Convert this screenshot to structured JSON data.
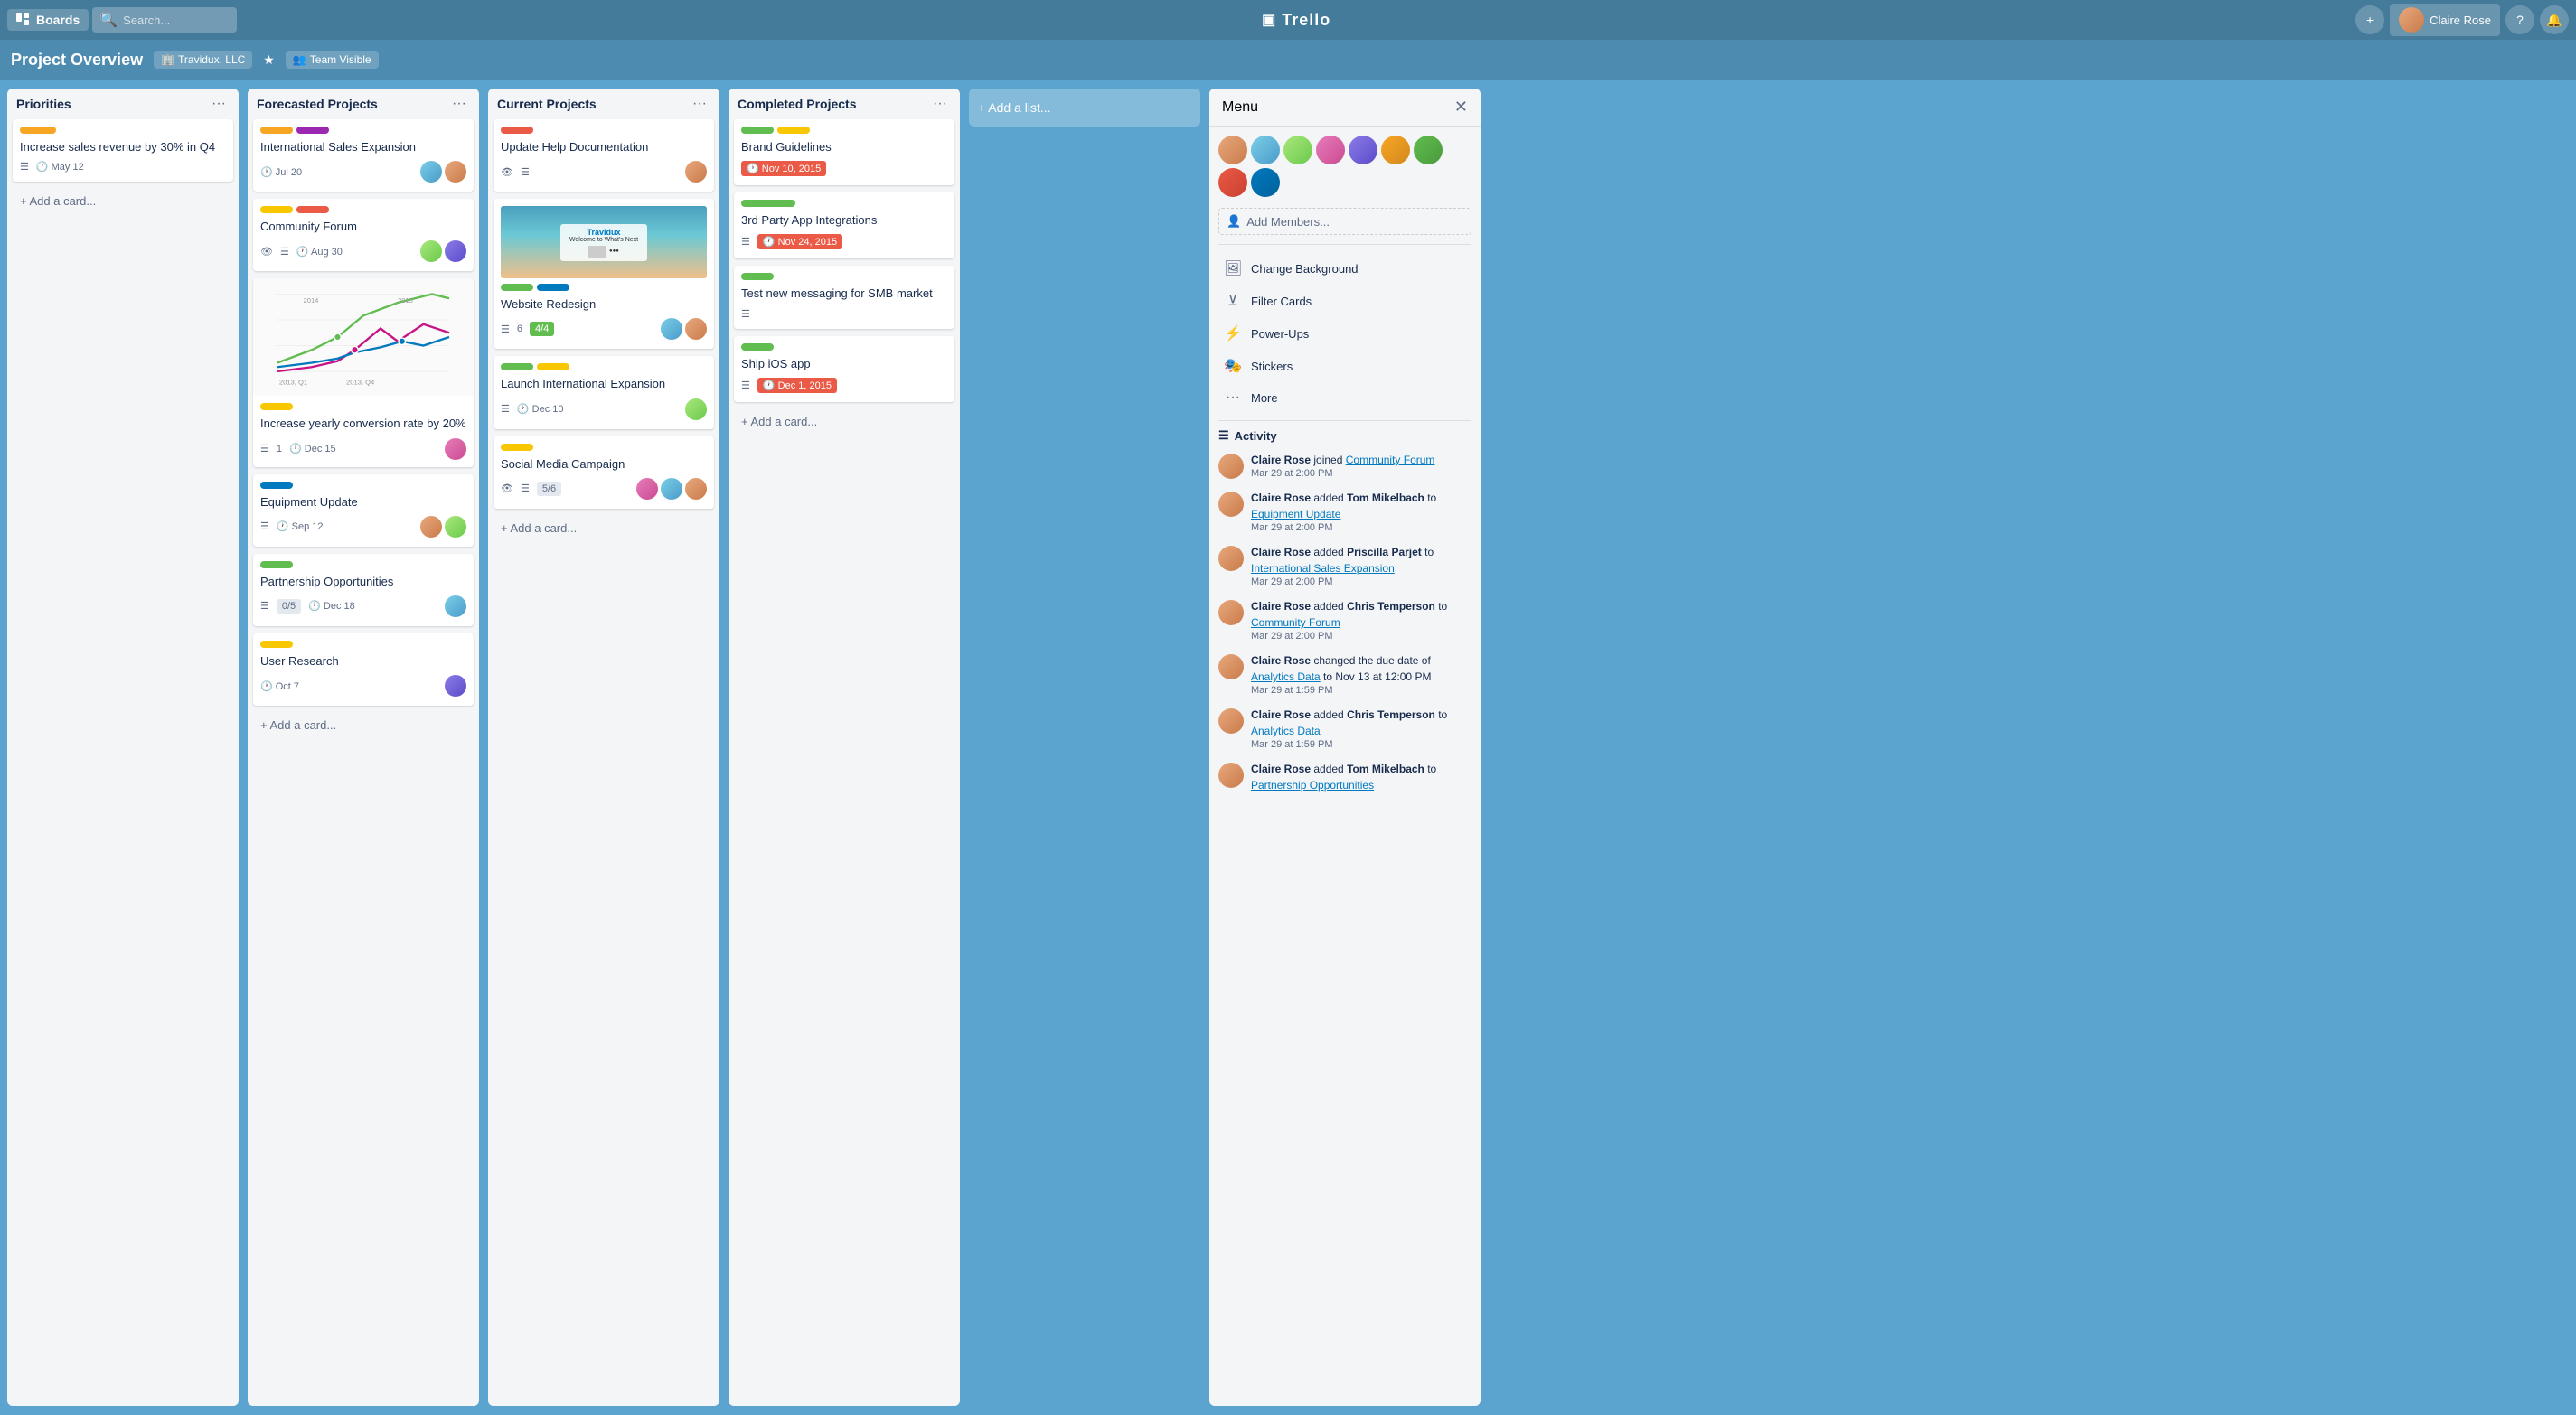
{
  "header": {
    "boards_label": "Boards",
    "search_placeholder": "Search...",
    "logo_text": "Trello",
    "add_btn": "+",
    "user_name": "Claire Rose",
    "help_icon": "?",
    "bell_icon": "🔔"
  },
  "board": {
    "title": "Project Overview",
    "org": "Travidux, LLC",
    "visibility": "Team Visible"
  },
  "columns": [
    {
      "id": "priorities",
      "title": "Priorities",
      "cards": [
        {
          "id": "p1",
          "labels": [
            {
              "color": "#f6a623",
              "width": 40
            }
          ],
          "title": "Increase sales revenue by 30% in Q4",
          "meta": [
            "checklist",
            "due"
          ],
          "due": "May 12",
          "due_style": "normal"
        }
      ]
    },
    {
      "id": "forecasted",
      "title": "Forecasted Projects",
      "cards": [
        {
          "id": "f1",
          "labels": [
            {
              "color": "#f6a623",
              "width": 36
            },
            {
              "color": "#9c27b0",
              "width": 36
            }
          ],
          "title": "International Sales Expansion",
          "due": "Jul 20",
          "due_style": "normal",
          "avatars": [
            "avatar-2",
            "avatar-1"
          ]
        },
        {
          "id": "f2",
          "labels": [
            {
              "color": "#f9c700",
              "width": 36
            },
            {
              "color": "#eb5a46",
              "width": 36
            }
          ],
          "title": "Community Forum",
          "due": "Aug 30",
          "due_style": "normal",
          "avatars": [
            "avatar-3",
            "avatar-5"
          ]
        },
        {
          "id": "f3",
          "chart": true,
          "labels": [
            {
              "color": "#f9c700",
              "width": 36
            }
          ],
          "title": "Increase yearly conversion rate by 20%",
          "checklist_count": "1",
          "due": "Dec 15",
          "due_style": "normal",
          "avatars": [
            "avatar-4"
          ]
        },
        {
          "id": "f4",
          "labels": [
            {
              "color": "#0079bf",
              "width": 36
            }
          ],
          "title": "Equipment Update",
          "due": "Sep 12",
          "due_style": "normal",
          "avatars": [
            "avatar-1",
            "avatar-3"
          ]
        },
        {
          "id": "f5",
          "labels": [
            {
              "color": "#61bd4f",
              "width": 36
            }
          ],
          "title": "Partnership Opportunities",
          "checklist": "0/5",
          "due": "Dec 18",
          "due_style": "normal",
          "avatars": [
            "avatar-2"
          ]
        },
        {
          "id": "f6",
          "labels": [
            {
              "color": "#f9c700",
              "width": 36
            }
          ],
          "title": "User Research",
          "due": "Oct 7",
          "due_style": "normal",
          "avatars": [
            "avatar-5"
          ]
        }
      ]
    },
    {
      "id": "current",
      "title": "Current Projects",
      "cards": [
        {
          "id": "c1",
          "labels": [
            {
              "color": "#eb5a46",
              "width": 36
            }
          ],
          "title": "Update Help Documentation",
          "has_image": false,
          "has_eye": true,
          "has_checklist_icon": true,
          "avatars": [
            "avatar-1"
          ]
        },
        {
          "id": "c2",
          "labels": [
            {
              "color": "#61bd4f",
              "width": 36
            },
            {
              "color": "#0079bf",
              "width": 36
            }
          ],
          "title": "Website Redesign",
          "has_website_img": true,
          "checklist": "4/4",
          "checklist_style": "green",
          "checklist_count": "6",
          "avatars": [
            "avatar-2",
            "avatar-1"
          ]
        },
        {
          "id": "c3",
          "labels": [
            {
              "color": "#61bd4f",
              "width": 36
            },
            {
              "color": "#f9c700",
              "width": 36
            }
          ],
          "title": "Launch International Expansion",
          "due": "Dec 10",
          "due_style": "normal",
          "avatars": [
            "avatar-3"
          ]
        },
        {
          "id": "c4",
          "labels": [
            {
              "color": "#f9c700",
              "width": 36
            }
          ],
          "title": "Social Media Campaign",
          "has_eye": true,
          "has_checklist_icon": true,
          "checklist": "5/6",
          "avatars": [
            "avatar-4",
            "avatar-2",
            "avatar-1"
          ]
        }
      ]
    },
    {
      "id": "completed",
      "title": "Completed Projects",
      "cards": [
        {
          "id": "cp1",
          "labels": [
            {
              "color": "#61bd4f",
              "width": 36
            },
            {
              "color": "#f9c700",
              "width": 36
            }
          ],
          "title": "Brand Guidelines",
          "due": "Nov 10, 2015",
          "due_style": "red"
        },
        {
          "id": "cp2",
          "labels": [
            {
              "color": "#61bd4f",
              "width": 60
            }
          ],
          "title": "3rd Party App Integrations",
          "due": "Nov 24, 2015",
          "due_style": "red"
        },
        {
          "id": "cp3",
          "labels": [
            {
              "color": "#61bd4f",
              "width": 36
            }
          ],
          "title": "Test new messaging for SMB market",
          "has_checklist_icon": true
        },
        {
          "id": "cp4",
          "labels": [
            {
              "color": "#61bd4f",
              "width": 36
            }
          ],
          "title": "Ship iOS app",
          "due": "Dec 1, 2015",
          "due_style": "red"
        }
      ]
    }
  ],
  "menu": {
    "title": "Menu",
    "add_members_label": "Add Members...",
    "items": [
      {
        "icon": "🖼",
        "label": "Change Background"
      },
      {
        "icon": "⊻",
        "label": "Filter Cards"
      },
      {
        "icon": "⚡",
        "label": "Power-Ups"
      },
      {
        "icon": "🎭",
        "label": "Stickers"
      },
      {
        "icon": "…",
        "label": "More"
      }
    ],
    "activity_title": "Activity",
    "activities": [
      {
        "user": "Claire Rose",
        "action": "joined",
        "link": "Community Forum",
        "time": "Mar 29 at 2:00 PM"
      },
      {
        "user": "Claire Rose",
        "action": "added",
        "person": "Tom Mikelbach",
        "action2": "to",
        "link": "Equipment Update",
        "time": "Mar 29 at 2:00 PM"
      },
      {
        "user": "Claire Rose",
        "action": "added",
        "person": "Priscilla Parjet",
        "action2": "to",
        "link": "International Sales Expansion",
        "time": "Mar 29 at 2:00 PM"
      },
      {
        "user": "Claire Rose",
        "action": "added",
        "person": "Chris Temperson",
        "action2": "to",
        "link": "Community Forum",
        "time": "Mar 29 at 2:00 PM"
      },
      {
        "user": "Claire Rose",
        "action": "changed the due date of",
        "link": "Analytics Data",
        "action2": "to Nov 13 at 12:00 PM",
        "time": "Mar 29 at 1:59 PM"
      },
      {
        "user": "Claire Rose",
        "action": "added",
        "person": "Chris Temperson",
        "action2": "to",
        "link": "Analytics Data",
        "time": "Mar 29 at 1:59 PM"
      },
      {
        "user": "Claire Rose",
        "action": "added",
        "person": "Tom Mikelbach",
        "action2": "to",
        "link": "Partnership Opportunities",
        "time": ""
      }
    ]
  }
}
